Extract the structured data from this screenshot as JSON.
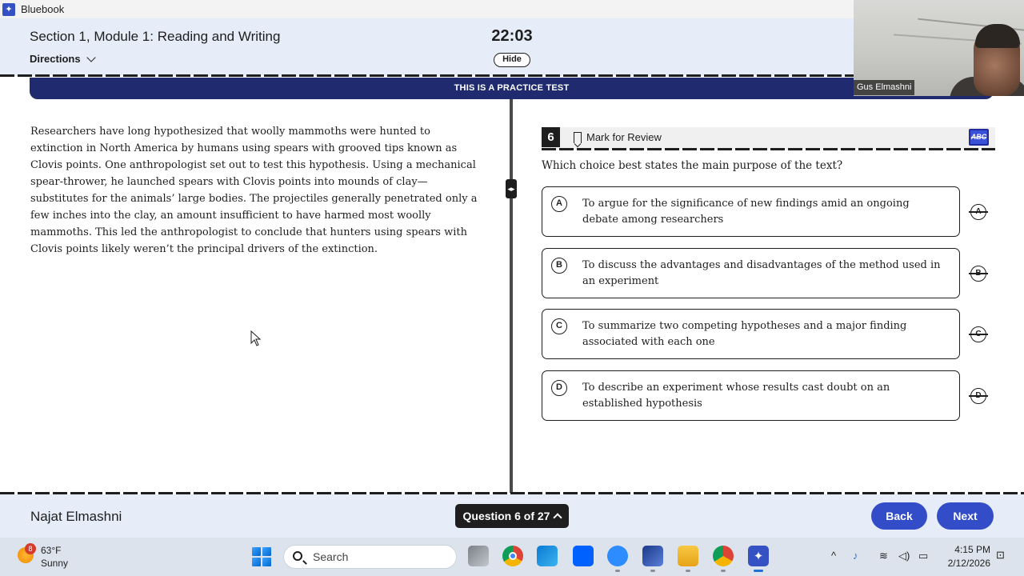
{
  "window": {
    "title": "Bluebook"
  },
  "header": {
    "section_title": "Section 1, Module 1: Reading and Writing",
    "directions_label": "Directions",
    "timer": "22:03",
    "hide_label": "Hide"
  },
  "banner": {
    "text": "THIS IS A PRACTICE TEST"
  },
  "webcam": {
    "participant_name": "Gus Elmashni"
  },
  "passage": {
    "text": "Researchers have long hypothesized that woolly mammoths were hunted to extinction in North America by humans using spears with grooved tips known as Clovis points. One anthropologist set out to test this hypothesis. Using a mechanical spear-thrower, he launched spears with Clovis points into mounds of clay—substitutes for the animals’ large bodies. The projectiles generally penetrated only a few inches into the clay, an amount insufficient to have harmed most woolly mammoths. This led the anthropologist to conclude that hunters using spears with Clovis points likely weren’t the principal drivers of the extinction."
  },
  "question": {
    "number": "6",
    "mark_for_review_label": "Mark for Review",
    "eliminator_label": "ABC",
    "prompt": "Which choice best states the main purpose of the text?",
    "choices": [
      {
        "letter": "A",
        "text": "To argue for the significance of new findings amid an ongoing debate among researchers"
      },
      {
        "letter": "B",
        "text": "To discuss the advantages and disadvantages of the method used in an experiment"
      },
      {
        "letter": "C",
        "text": "To summarize two competing hypotheses and a major finding associated with each one"
      },
      {
        "letter": "D",
        "text": "To describe an experiment whose results cast doubt on an established hypothesis"
      }
    ]
  },
  "footer": {
    "student_name": "Najat Elmashni",
    "question_nav_label": "Question 6 of 27",
    "back_label": "Back",
    "next_label": "Next"
  },
  "taskbar": {
    "weather_temp": "63°F",
    "weather_desc": "Sunny",
    "weather_badge": "8",
    "search_placeholder": "Search",
    "time": "4:15 PM",
    "date": "2/12/2026",
    "apps": [
      "file-explorer-icon",
      "chrome-icon",
      "remote-desktop-icon",
      "dropbox-icon",
      "zoom-icon",
      "task-manager-icon",
      "folder-icon",
      "chrome-profile-icon",
      "bluebook-icon"
    ]
  },
  "colors": {
    "header_bg": "#e6edf8",
    "banner_bg": "#1f2b6e",
    "button_blue": "#324dc7",
    "text_dark": "#1e1e1e"
  }
}
